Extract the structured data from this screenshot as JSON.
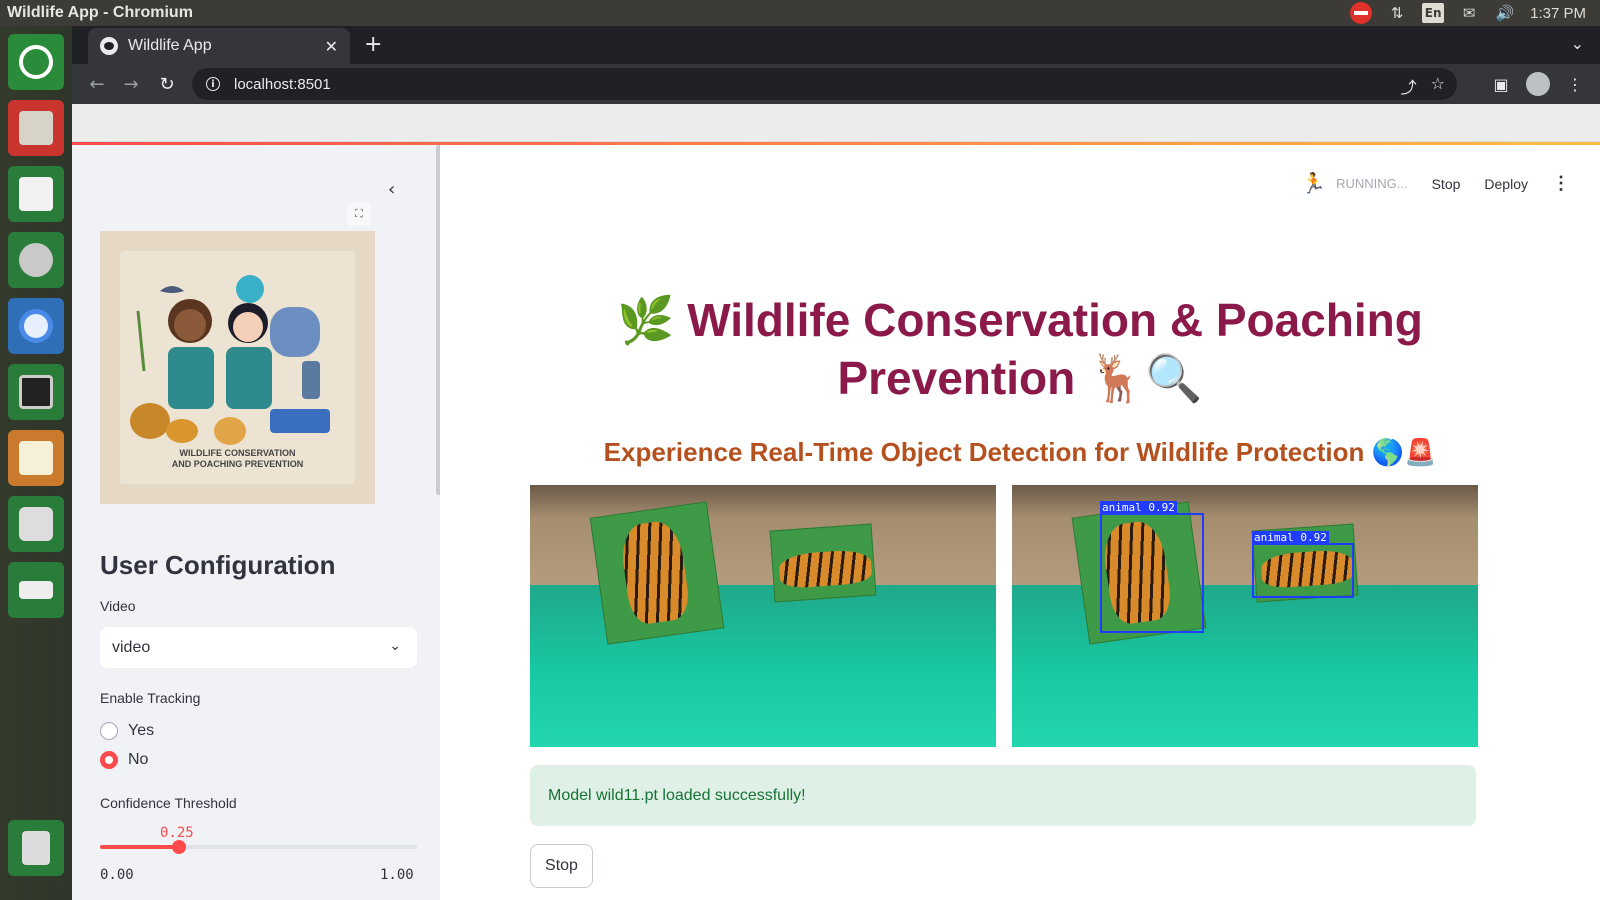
{
  "os": {
    "window_title": "Wildlife App - Chromium",
    "tray": {
      "lang": "En",
      "clock": "1:37 PM"
    },
    "launcher_icons": [
      "ubuntu-icon",
      "files-icon",
      "software-store-icon",
      "settings-icon",
      "chromium-icon",
      "display-icon",
      "text-editor-icon",
      "camera-icon",
      "drive-icon",
      "trash-icon"
    ]
  },
  "browser": {
    "tab_title": "Wildlife App",
    "tab_close": "✕",
    "new_tab": "+",
    "url": "localhost:8501"
  },
  "sidebar": {
    "collapse_glyph": "‹",
    "logo_caption_line1": "WILDLIFE CONSERVATION",
    "logo_caption_line2": "AND POACHING PREVENTION",
    "title": "User Configuration",
    "video_label": "Video",
    "video_value": "video",
    "tracking_label": "Enable Tracking",
    "tracking_options": [
      "Yes",
      "No"
    ],
    "tracking_selected": "No",
    "confidence_label": "Confidence Threshold",
    "confidence_value": "0.25",
    "confidence_fraction": 0.25,
    "confidence_min": "0.00",
    "confidence_max": "1.00"
  },
  "header": {
    "status": "RUNNING...",
    "stop": "Stop",
    "deploy": "Deploy"
  },
  "main": {
    "title_emoji_left": "🌿",
    "title_line1": "Wildlife Conservation & Poaching",
    "title_line2": "Prevention",
    "title_emoji_right": "🦌🔍",
    "subtitle": "Experience Real-Time Object Detection for Wildlife Protection",
    "subtitle_emoji": "🌎🚨",
    "detections": [
      {
        "label": "animal 0.92"
      },
      {
        "label": "animal 0.92"
      }
    ],
    "success_message": "Model wild11.pt loaded successfully!",
    "stop_button": "Stop"
  },
  "colors": {
    "accent": "#ff4b4b",
    "title": "#8b1a4a",
    "subtitle": "#b5511f",
    "bbox": "#1f3cff"
  }
}
